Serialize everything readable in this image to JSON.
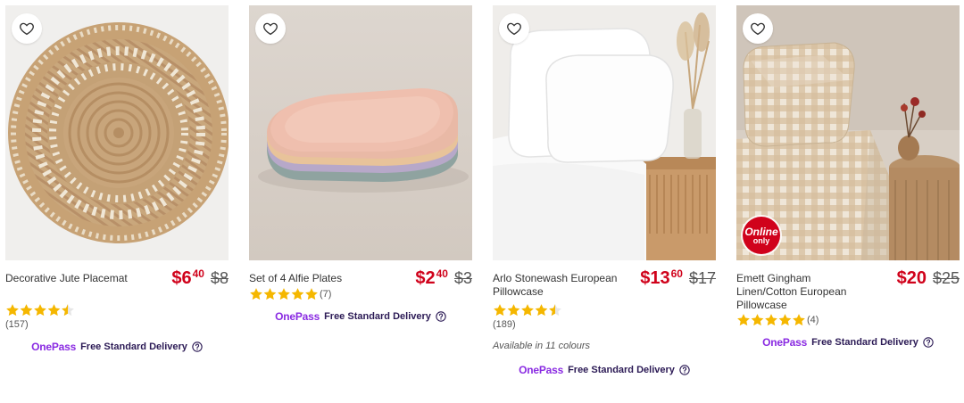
{
  "colors": {
    "sale_price": "#d0021b",
    "onepass_purple": "#8a2be2",
    "star_gold": "#f5b700",
    "online_badge": "#d0021b"
  },
  "products": [
    {
      "name": "Decorative Jute Placemat",
      "price_whole": "$6",
      "price_cents": "40",
      "was_price": "$8",
      "rating": 4.5,
      "review_count": "(157)",
      "delivery_brand": "OnePass",
      "delivery_text": "Free Standard Delivery",
      "heart_icon": "heart-outline-icon"
    },
    {
      "name": "Set of 4 Alfie Plates",
      "price_whole": "$2",
      "price_cents": "40",
      "was_price": "$3",
      "rating": 5,
      "review_count": "(7)",
      "delivery_brand": "OnePass",
      "delivery_text": "Free Standard Delivery",
      "heart_icon": "heart-outline-icon"
    },
    {
      "name": "Arlo Stonewash European Pillowcase",
      "price_whole": "$13",
      "price_cents": "60",
      "was_price": "$17",
      "rating": 4.5,
      "review_count": "(189)",
      "colours_text": "Available in 11 colours",
      "delivery_brand": "OnePass",
      "delivery_text": "Free Standard Delivery",
      "heart_icon": "heart-outline-icon"
    },
    {
      "name": "Emett Gingham Linen/Cotton European Pillowcase",
      "price_whole": "$20",
      "was_price": "$25",
      "rating": 5,
      "review_count": "(4)",
      "badge_line1": "Online",
      "badge_line2": "only",
      "delivery_brand": "OnePass",
      "delivery_text": "Free Standard Delivery",
      "heart_icon": "heart-outline-icon"
    }
  ]
}
